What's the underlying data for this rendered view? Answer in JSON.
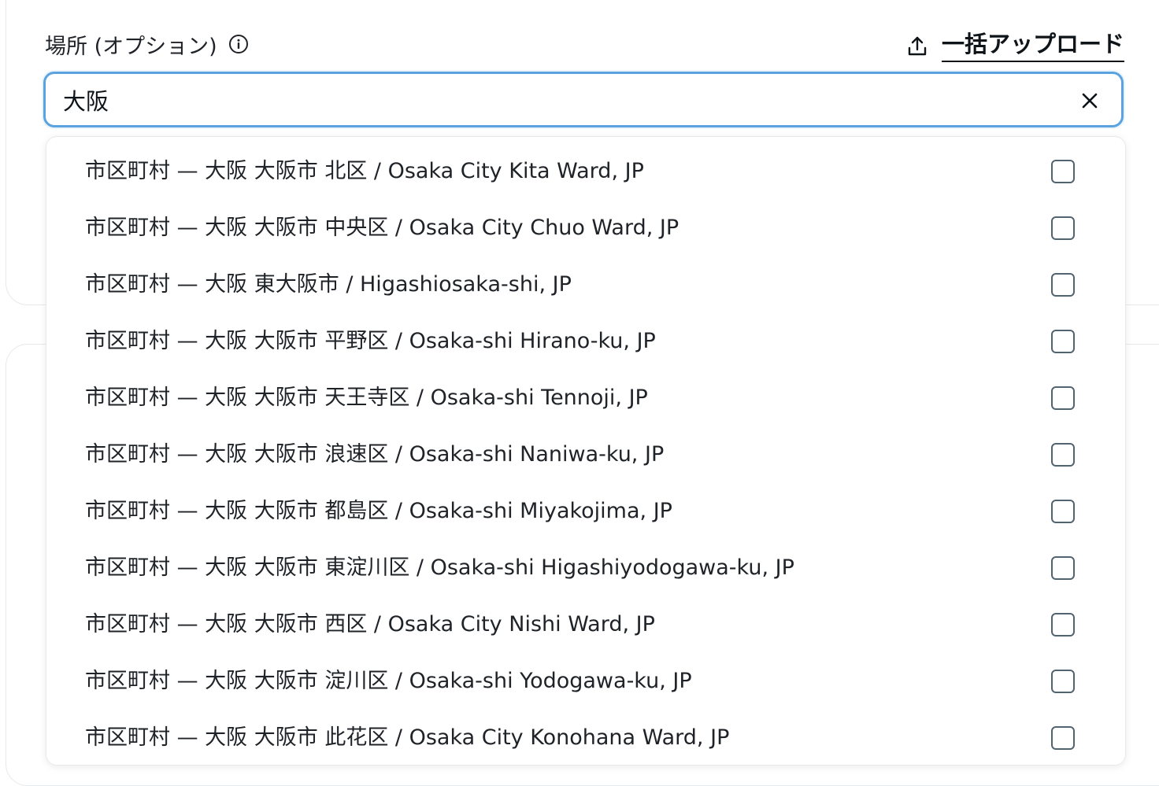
{
  "field": {
    "label": "場所 (オプション)",
    "info_icon": "info-icon"
  },
  "bulk_upload": {
    "label": "一括アップロード",
    "icon": "upload-icon"
  },
  "search": {
    "value": "大阪",
    "clear_icon": "close-icon"
  },
  "colors": {
    "focus_border": "#5aa3e0",
    "checkbox_border": "#536471",
    "text": "#1f2328"
  },
  "options": [
    {
      "label": "市区町村 — 大阪 大阪市 北区 / Osaka City Kita Ward, JP",
      "checked": false
    },
    {
      "label": "市区町村 — 大阪 大阪市 中央区 / Osaka City Chuo Ward, JP",
      "checked": false
    },
    {
      "label": "市区町村 — 大阪 東大阪市 / Higashiosaka-shi, JP",
      "checked": false
    },
    {
      "label": "市区町村 — 大阪 大阪市 平野区 / Osaka-shi Hirano-ku, JP",
      "checked": false
    },
    {
      "label": "市区町村 — 大阪 大阪市 天王寺区 / Osaka-shi Tennoji, JP",
      "checked": false
    },
    {
      "label": "市区町村 — 大阪 大阪市 浪速区 / Osaka-shi Naniwa-ku, JP",
      "checked": false
    },
    {
      "label": "市区町村 — 大阪 大阪市 都島区 / Osaka-shi Miyakojima, JP",
      "checked": false
    },
    {
      "label": "市区町村 — 大阪 大阪市 東淀川区 / Osaka-shi Higashiyodogawa-ku, JP",
      "checked": false
    },
    {
      "label": "市区町村 — 大阪 大阪市 西区 / Osaka City Nishi Ward, JP",
      "checked": false
    },
    {
      "label": "市区町村 — 大阪 大阪市 淀川区 / Osaka-shi Yodogawa-ku, JP",
      "checked": false
    },
    {
      "label": "市区町村 — 大阪 大阪市 此花区 / Osaka City Konohana Ward, JP",
      "checked": false
    }
  ]
}
